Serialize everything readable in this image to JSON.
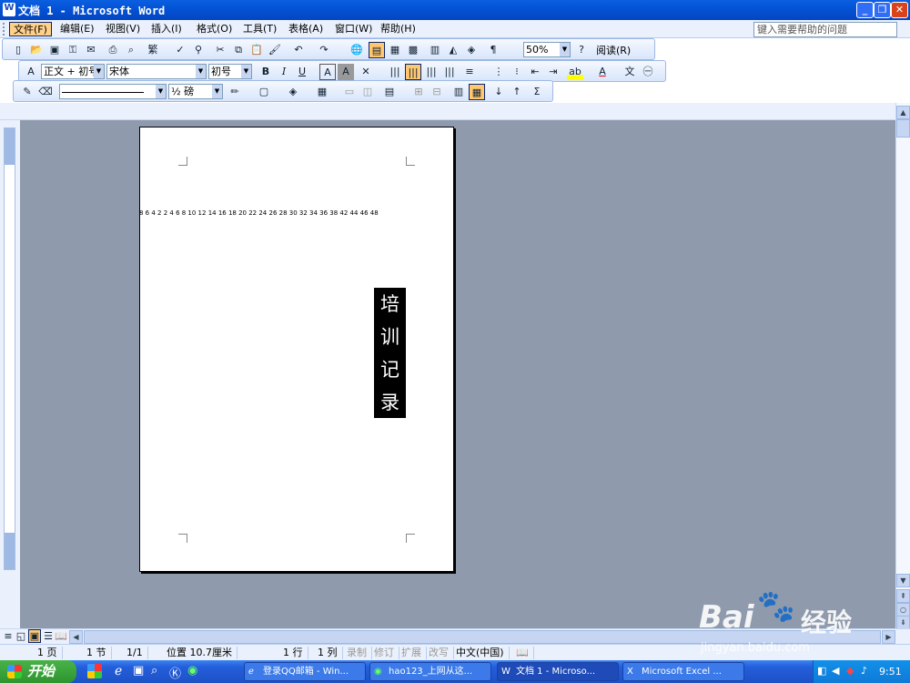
{
  "window": {
    "title": "文档 1 - Microsoft Word"
  },
  "menu": [
    "文件(F)",
    "编辑(E)",
    "视图(V)",
    "插入(I)",
    "格式(O)",
    "工具(T)",
    "表格(A)",
    "窗口(W)",
    "帮助(H)"
  ],
  "help_box": {
    "placeholder": "键入需要帮助的问题"
  },
  "toolbar": {
    "zoom": "50%",
    "read_label": "阅读(R)",
    "style": "正文 + 初号",
    "font": "宋体",
    "size": "初号",
    "line_weight": "½ 磅"
  },
  "ruler": {
    "h_ticks": "8 6 4 2      2  4  6  8 10 12 14 16 18 20 22 24 26 28 30 32 34 36 38     42 44 46 48"
  },
  "document": {
    "chars": [
      "培",
      "训",
      "记",
      "录"
    ]
  },
  "status": {
    "page": "1 页",
    "section": "1 节",
    "page_of": "1/1",
    "position": "位置 10.7厘米",
    "line": "1 行",
    "column": "1 列",
    "rec": "录制",
    "trk": "修订",
    "ext": "扩展",
    "ovr": "改写",
    "language": "中文(中国)"
  },
  "taskbar": {
    "start": "开始",
    "tasks": [
      "登录QQ邮箱 - Win...",
      "hao123_上网从这...",
      "文档 1 - Microso...",
      "Microsoft Excel ..."
    ],
    "clock": "9:51"
  },
  "watermark": {
    "brand": "Bai",
    "brand2": "经验",
    "url": "jingyan.baidu.com"
  }
}
